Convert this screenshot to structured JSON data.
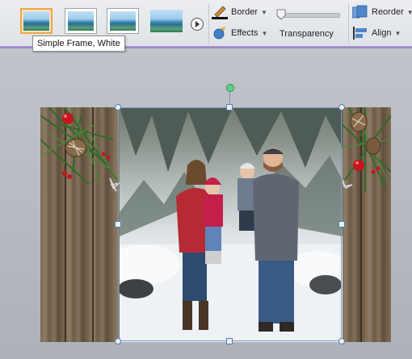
{
  "ribbon": {
    "picture_styles": [
      {
        "name": "Simple Frame, White",
        "selected": true
      },
      {
        "name": "",
        "selected": false
      },
      {
        "name": "",
        "selected": false
      },
      {
        "name": "",
        "selected": false
      }
    ],
    "tooltip": "Simple Frame, White",
    "border_label": "Border",
    "effects_label": "Effects",
    "transparency_label": "Transparency",
    "transparency_value": 0,
    "reorder_label": "Reorder",
    "align_label": "Align"
  },
  "icons": {
    "next": "chevron-right-icon",
    "border": "pen-icon",
    "effects": "effects-icon",
    "reorder": "reorder-icon",
    "align": "align-icon"
  },
  "colors": {
    "accent": "#9a7fc6",
    "selection": "#f0a640",
    "rotate_handle": "#5ed08a"
  }
}
